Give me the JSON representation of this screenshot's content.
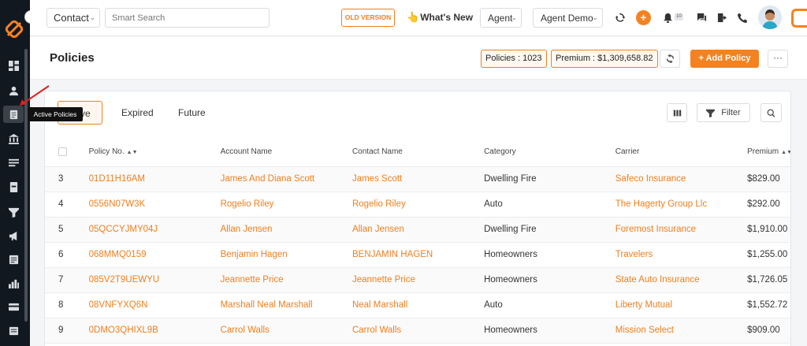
{
  "sidebar": {
    "tooltip": "Active Policies",
    "items": [
      {
        "icon": "dashboard-icon"
      },
      {
        "icon": "contacts-icon"
      },
      {
        "icon": "policies-icon",
        "active": true
      },
      {
        "icon": "carriers-icon"
      },
      {
        "icon": "list-icon"
      },
      {
        "icon": "document-icon"
      },
      {
        "icon": "filter-icon"
      },
      {
        "icon": "megaphone-icon"
      },
      {
        "icon": "forms-icon"
      },
      {
        "icon": "reports-icon"
      },
      {
        "icon": "billing-icon"
      },
      {
        "icon": "calendar-icon"
      }
    ]
  },
  "topbar": {
    "contact_select": "Contact",
    "search_placeholder": "Smart Search",
    "old_version": "OLD VERSION",
    "whats_new": "What's New",
    "agent_select": "Agent",
    "agent_demo": "Agent Demo",
    "notif_count": "10"
  },
  "page": {
    "title": "Policies",
    "policies_count": "Policies : 1023",
    "premium_total": "Premium : $1,309,658.82",
    "add_policy": "+ Add Policy",
    "more": "···"
  },
  "tabs": [
    {
      "label": "ve",
      "active": true
    },
    {
      "label": "Expired"
    },
    {
      "label": "Future"
    }
  ],
  "toolbar": {
    "filter_label": "Filter"
  },
  "table": {
    "headers": [
      "Policy No.",
      "Account Name",
      "Contact Name",
      "Category",
      "Carrier",
      "Premium"
    ],
    "rows": [
      {
        "id": "3",
        "policy": "01D11H16AM",
        "account": "James And Diana Scott",
        "contact": "James Scott",
        "category": "Dwelling Fire",
        "carrier": "Safeco Insurance",
        "premium": "$829.00"
      },
      {
        "id": "4",
        "policy": "0556N07W3K",
        "account": "Rogelio Riley",
        "contact": "Rogelio Riley",
        "category": "Auto",
        "carrier": "The Hagerty Group Llc",
        "premium": "$292.00"
      },
      {
        "id": "5",
        "policy": "05QCCYJMY04J",
        "account": "Allan Jensen",
        "contact": "Allan Jensen",
        "category": "Dwelling Fire",
        "carrier": "Foremost Insurance",
        "premium": "$1,910.00"
      },
      {
        "id": "6",
        "policy": "068MMQ0159",
        "account": "Benjamin Hagen",
        "contact": "BENJAMIN HAGEN",
        "category": "Homeowners",
        "carrier": "Travelers",
        "premium": "$1,255.00"
      },
      {
        "id": "7",
        "policy": "085V2T9UEWYU",
        "account": "Jeannette Price",
        "contact": "Jeannette Price",
        "category": "Homeowners",
        "carrier": "State Auto Insurance",
        "premium": "$1,726.05"
      },
      {
        "id": "8",
        "policy": "08VNFYXQ6N",
        "account": "Marshall Neal Marshall",
        "contact": "Neal Marshall",
        "category": "Auto",
        "carrier": "Liberty Mutual",
        "premium": "$1,552.72"
      },
      {
        "id": "9",
        "policy": "0DMO3QHIXL9B",
        "account": "Carrol Walls",
        "contact": "Carrol Walls",
        "category": "Homeowners",
        "carrier": "Mission Select",
        "premium": "$909.00"
      }
    ]
  },
  "colors": {
    "accent": "#f58220",
    "sidebar_bg": "#12181f"
  }
}
